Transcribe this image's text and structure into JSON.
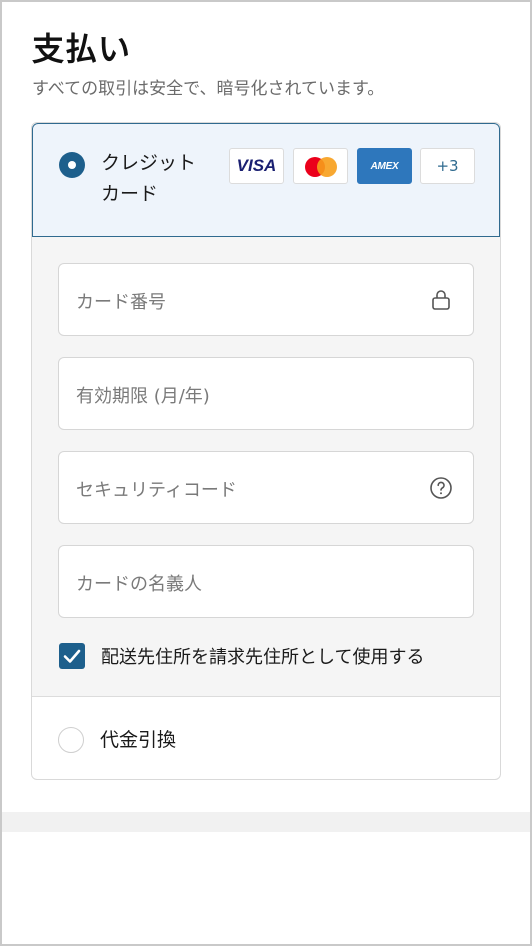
{
  "page": {
    "title": "支払い",
    "subtitle": "すべての取引は安全で、暗号化されています。"
  },
  "credit_card": {
    "label": "クレジット\nカード",
    "selected": true,
    "brands": {
      "visa": "VISA",
      "mastercard_icon": "mastercard-logo",
      "amex": "AMEX",
      "more": "+3"
    }
  },
  "fields": {
    "card_number": {
      "placeholder": "カード番号",
      "icon": "lock-icon"
    },
    "expiry": {
      "placeholder": "有効期限 (月/年)"
    },
    "security_code": {
      "placeholder": "セキュリティコード",
      "icon": "question-circle-icon"
    },
    "name_on_card": {
      "placeholder": "カードの名義人"
    }
  },
  "billing": {
    "same_as_shipping_label": "配送先住所を請求先住所として使用する",
    "checked": true
  },
  "cod": {
    "label": "代金引換",
    "selected": false
  },
  "colors": {
    "accent": "#1d5f8c",
    "selected_bg": "#eef4fb",
    "fields_bg": "#f5f5f5"
  }
}
